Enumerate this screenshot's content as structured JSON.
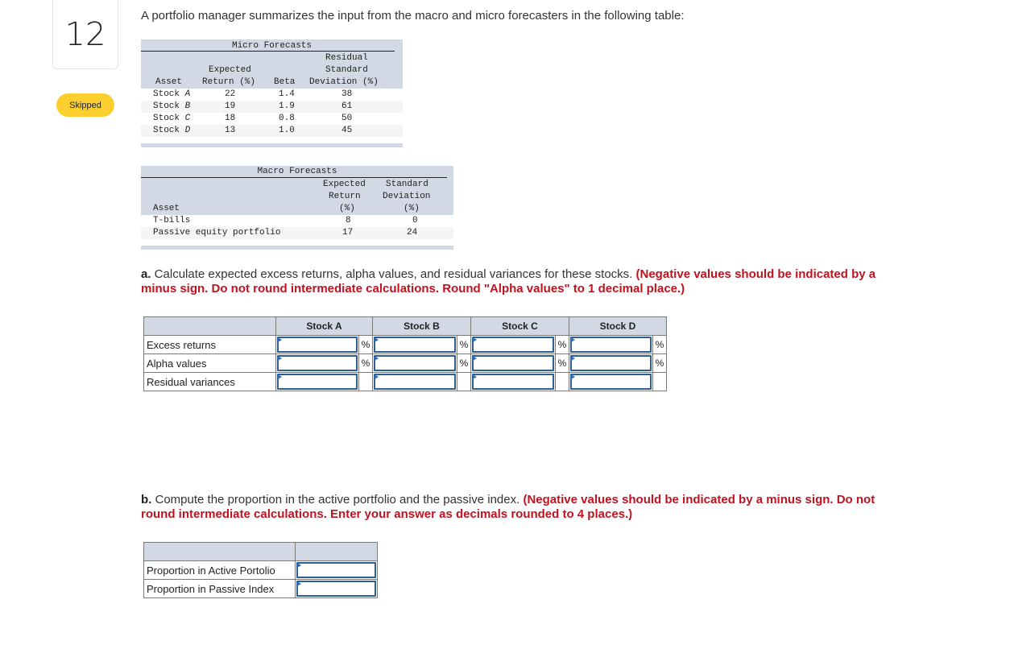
{
  "question": {
    "number": "12",
    "status": "Skipped"
  },
  "intro": "A portfolio manager summarizes the input from the macro and micro forecasters in the following table:",
  "micro_table": {
    "title": "Micro Forecasts",
    "headers": {
      "asset": "Asset",
      "expected_return_l1": "Expected",
      "expected_return_l2": "Return (%)",
      "beta": "Beta",
      "resid_l1": "Residual",
      "resid_l2": "Standard",
      "resid_l3": "Deviation (%)"
    },
    "rows": [
      {
        "asset_prefix": "Stock ",
        "asset_letter": "A",
        "expected_return": "22",
        "beta": "1.4",
        "residual_sd": "38"
      },
      {
        "asset_prefix": "Stock ",
        "asset_letter": "B",
        "expected_return": "19",
        "beta": "1.9",
        "residual_sd": "61"
      },
      {
        "asset_prefix": "Stock ",
        "asset_letter": "C",
        "expected_return": "18",
        "beta": "0.8",
        "residual_sd": "50"
      },
      {
        "asset_prefix": "Stock ",
        "asset_letter": "D",
        "expected_return": "13",
        "beta": "1.0",
        "residual_sd": "45"
      }
    ]
  },
  "macro_table": {
    "title": "Macro Forecasts",
    "headers": {
      "asset": "Asset",
      "er_l1": "Expected",
      "er_l2": "Return",
      "er_l3": "(%)",
      "sd_l1": "Standard",
      "sd_l2": "Deviation",
      "sd_l3": "(%)"
    },
    "rows": [
      {
        "asset": "T-bills",
        "expected_return": "8",
        "sd": "0"
      },
      {
        "asset": "Passive equity portfolio",
        "expected_return": "17",
        "sd": "24"
      }
    ]
  },
  "part_a": {
    "label": "a.",
    "text": " Calculate expected excess returns, alpha values, and residual variances for these stocks. ",
    "note": "(Negative values should be indicated by a minus sign. Do not round intermediate calculations. Round \"Alpha values\" to 1 decimal place.)",
    "columns": [
      "Stock A",
      "Stock B",
      "Stock C",
      "Stock D"
    ],
    "rows": [
      {
        "label": "Excess returns",
        "unit": "%",
        "values": [
          "",
          "",
          "",
          ""
        ]
      },
      {
        "label": "Alpha values",
        "unit": "%",
        "values": [
          "",
          "",
          "",
          ""
        ]
      },
      {
        "label": "Residual variances",
        "unit": "",
        "values": [
          "",
          "",
          "",
          ""
        ]
      }
    ]
  },
  "part_b": {
    "label": "b.",
    "text": " Compute the proportion in the active portfolio and the passive index. ",
    "note": "(Negative values should be indicated by a minus sign. Do not round intermediate calculations. Enter your answer as decimals rounded to 4 places.)",
    "rows": [
      {
        "label": "Proportion in Active Portolio",
        "value": ""
      },
      {
        "label": "Proportion in Passive Index",
        "value": ""
      }
    ]
  }
}
